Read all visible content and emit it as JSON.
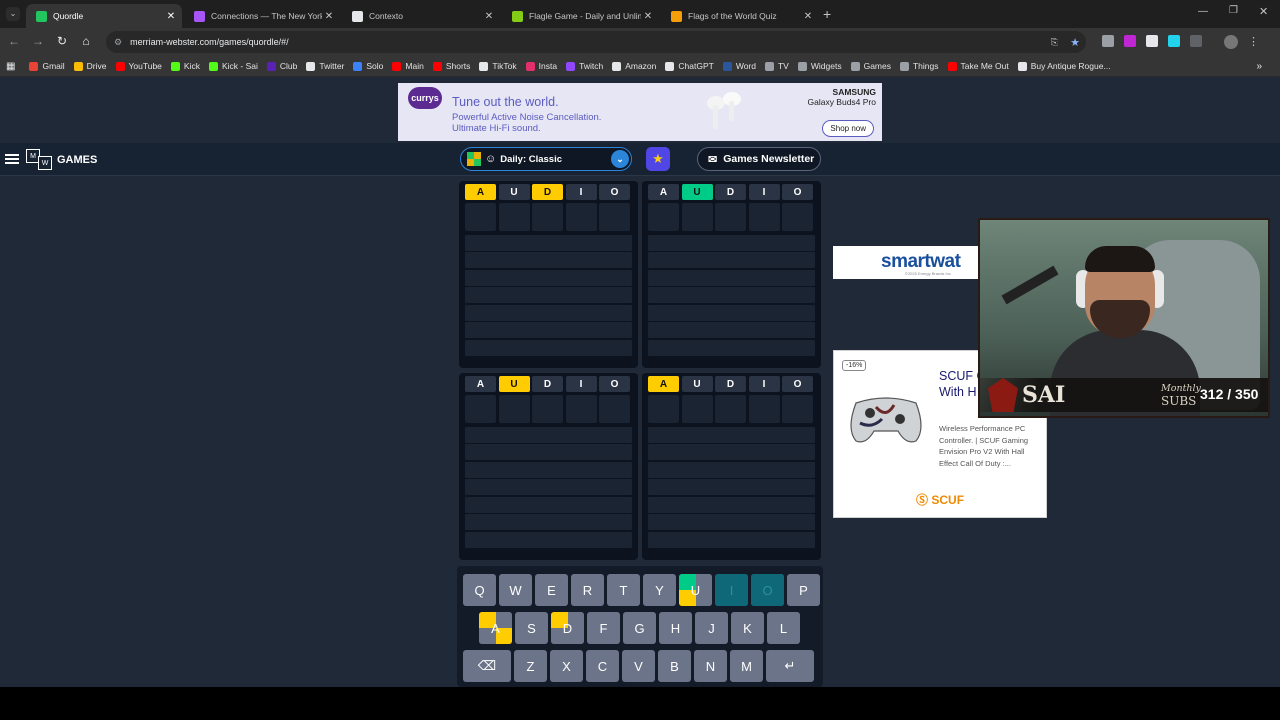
{
  "browser": {
    "tabs": [
      {
        "title": "Quordle",
        "active": true,
        "favicon_color": "#22c55e"
      },
      {
        "title": "Connections — The New York",
        "active": false,
        "favicon_color": "#a855f7"
      },
      {
        "title": "Contexto",
        "active": false,
        "favicon_color": "#e5e7eb"
      },
      {
        "title": "Flagle Game - Daily and Unlim",
        "active": false,
        "favicon_color": "#84cc16"
      },
      {
        "title": "Flags of the World Quiz",
        "active": false,
        "favicon_color": "#f59e0b"
      }
    ],
    "new_tab": "+",
    "url": "merriam-webster.com/games/quordle/#/",
    "bookmarks": [
      {
        "label": "Gmail",
        "color": "#ea4335"
      },
      {
        "label": "Drive",
        "color": "#fbbc04"
      },
      {
        "label": "YouTube",
        "color": "#ff0000"
      },
      {
        "label": "Kick",
        "color": "#53fc18"
      },
      {
        "label": "Kick - Sai",
        "color": "#53fc18"
      },
      {
        "label": "Club",
        "color": "#5b21b6"
      },
      {
        "label": "Twitter",
        "color": "#e5e7eb"
      },
      {
        "label": "Solo",
        "color": "#3b82f6"
      },
      {
        "label": "Main",
        "color": "#ff0000"
      },
      {
        "label": "Shorts",
        "color": "#ff0000"
      },
      {
        "label": "TikTok",
        "color": "#e5e7eb"
      },
      {
        "label": "Insta",
        "color": "#e1306c"
      },
      {
        "label": "Twitch",
        "color": "#9146ff"
      },
      {
        "label": "Amazon",
        "color": "#e5e7eb"
      },
      {
        "label": "ChatGPT",
        "color": "#e5e7eb"
      },
      {
        "label": "Word",
        "color": "#2b579a"
      },
      {
        "label": "TV",
        "color": "#9aa0a6"
      },
      {
        "label": "Widgets",
        "color": "#9aa0a6"
      },
      {
        "label": "Games",
        "color": "#9aa0a6"
      },
      {
        "label": "Things",
        "color": "#9aa0a6"
      },
      {
        "label": "Take Me Out",
        "color": "#ff0000"
      },
      {
        "label": "Buy Antique Rogue...",
        "color": "#e5e7eb"
      }
    ]
  },
  "ad_top": {
    "brand": "currys",
    "headline": "Tune out the world.",
    "line1": "Powerful Active Noise Cancellation.",
    "line2": "Ultimate Hi-Fi sound.",
    "maker": "SAMSUNG",
    "product": "Galaxy Buds4 Pro",
    "cta": "Shop now"
  },
  "header": {
    "logo_m": "M",
    "logo_w": "W",
    "logo_text": "GAMES",
    "mode_label": "Daily: Classic",
    "newsletter": "Games Newsletter"
  },
  "boards": [
    {
      "guess": [
        {
          "l": "A",
          "s": "yellow"
        },
        {
          "l": "U",
          "s": "gray"
        },
        {
          "l": "D",
          "s": "yellow"
        },
        {
          "l": "I",
          "s": "gray"
        },
        {
          "l": "O",
          "s": "gray"
        }
      ]
    },
    {
      "guess": [
        {
          "l": "A",
          "s": "gray"
        },
        {
          "l": "U",
          "s": "green"
        },
        {
          "l": "D",
          "s": "gray"
        },
        {
          "l": "I",
          "s": "gray"
        },
        {
          "l": "O",
          "s": "gray"
        }
      ]
    },
    {
      "guess": [
        {
          "l": "A",
          "s": "gray"
        },
        {
          "l": "U",
          "s": "yellow"
        },
        {
          "l": "D",
          "s": "gray"
        },
        {
          "l": "I",
          "s": "gray"
        },
        {
          "l": "O",
          "s": "gray"
        }
      ]
    },
    {
      "guess": [
        {
          "l": "A",
          "s": "yellow"
        },
        {
          "l": "U",
          "s": "gray"
        },
        {
          "l": "D",
          "s": "gray"
        },
        {
          "l": "I",
          "s": "gray"
        },
        {
          "l": "O",
          "s": "gray"
        }
      ]
    }
  ],
  "colors": {
    "yellow": "#ffcc00",
    "green": "#00cc88",
    "gray": "#6b7488",
    "absent": "#0e6878",
    "bg": "#1f2937"
  },
  "keyboard": {
    "rows": [
      [
        "Q",
        "W",
        "E",
        "R",
        "T",
        "Y",
        "U",
        "I",
        "O",
        "P"
      ],
      [
        "A",
        "S",
        "D",
        "F",
        "G",
        "H",
        "J",
        "K",
        "L"
      ],
      [
        "⌫",
        "Z",
        "X",
        "C",
        "V",
        "B",
        "N",
        "M",
        "↵"
      ]
    ],
    "states": {
      "U": [
        "green",
        "gray",
        "yellow",
        "gray"
      ],
      "A": [
        "yellow",
        "gray",
        "gray",
        "yellow"
      ],
      "D": [
        "yellow",
        "gray",
        "gray",
        "gray"
      ],
      "I": [
        "absent",
        "absent",
        "absent",
        "absent"
      ],
      "O": [
        "absent",
        "absent",
        "absent",
        "absent"
      ]
    }
  },
  "ad_smart": {
    "text": "smartwat",
    "fine": "©2025 Energy Brands Inc"
  },
  "ad_scuf": {
    "discount": "-16%",
    "title": "SCUF G Envisio With H",
    "desc": "Wireless Performance PC Controller. | SCUF Gaming Envision Pro V2 With Hall Effect Call Of Duty :...",
    "brand": "SCUF"
  },
  "webcam": {
    "name": "SAI",
    "monthly": "Monthly",
    "subs_label": "SUBS",
    "count": "312 / 350",
    "subs_current": 312,
    "subs_goal": 350
  }
}
